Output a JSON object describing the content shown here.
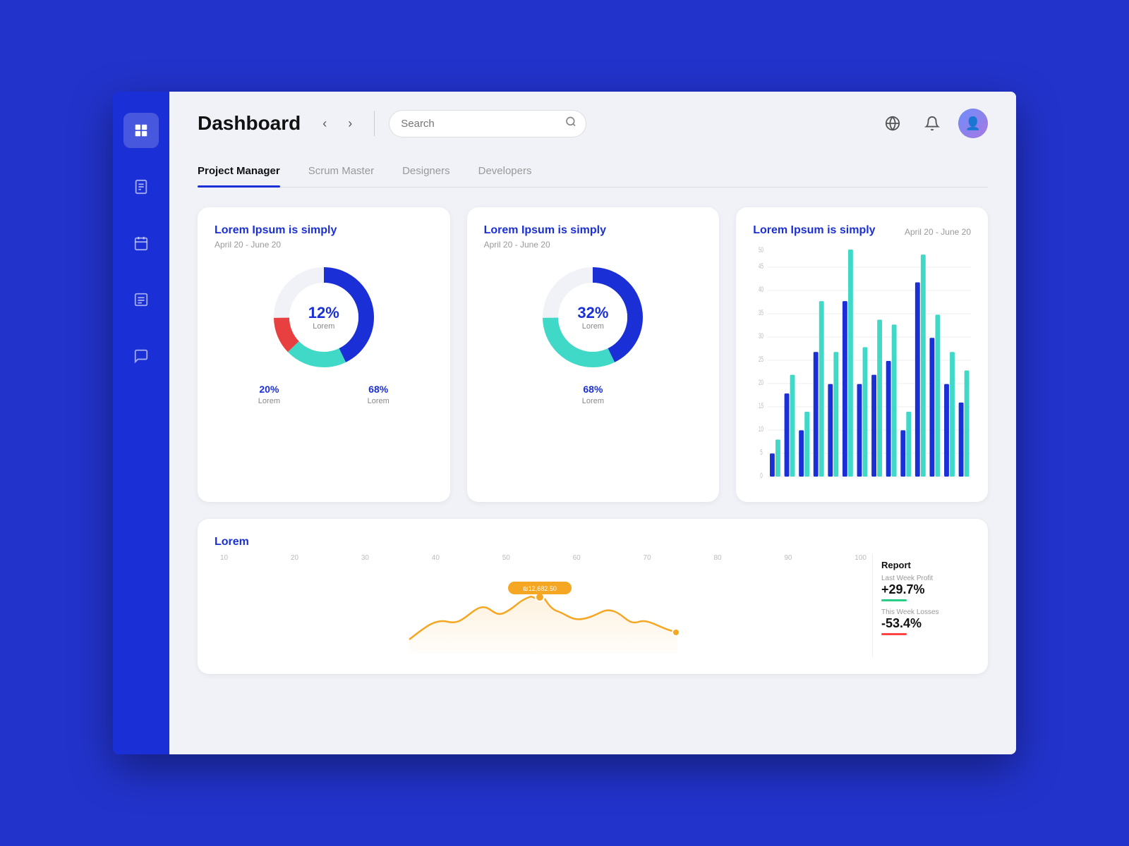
{
  "sidebar": {
    "items": [
      {
        "label": "dashboard",
        "icon": "🏛",
        "active": true
      },
      {
        "label": "reports",
        "icon": "📋",
        "active": false
      },
      {
        "label": "calendar",
        "icon": "📅",
        "active": false
      },
      {
        "label": "tasks",
        "icon": "📝",
        "active": false
      },
      {
        "label": "messages",
        "icon": "💬",
        "active": false
      }
    ]
  },
  "header": {
    "title": "Dashboard",
    "back_label": "‹",
    "forward_label": "›",
    "search_placeholder": "Search"
  },
  "tabs": [
    {
      "label": "Project Manager",
      "active": true
    },
    {
      "label": "Scrum Master",
      "active": false
    },
    {
      "label": "Designers",
      "active": false
    },
    {
      "label": "Developers",
      "active": false
    }
  ],
  "donut1": {
    "title": "Lorem Ipsum is simply",
    "subtitle": "April 20 - June 20",
    "center_pct": "12%",
    "center_label": "Lorem",
    "segments": [
      {
        "color": "#1a2fd6",
        "pct": 68,
        "label": "68%",
        "text": "Lorem"
      },
      {
        "color": "#40d9c8",
        "pct": 20,
        "label": "20%",
        "text": "Lorem"
      },
      {
        "color": "#e84040",
        "pct": 12,
        "label": "12%",
        "text": "Lorem"
      }
    ],
    "legend": [
      {
        "pct": "20%",
        "label": "Lorem",
        "color": "#40d9c8"
      },
      {
        "pct": "68%",
        "label": "Lorem",
        "color": "#1a2fd6"
      }
    ]
  },
  "donut2": {
    "title": "Lorem Ipsum is simply",
    "subtitle": "April 20 - June 20",
    "center_pct": "32%",
    "center_label": "Lorem",
    "segments": [
      {
        "color": "#1a2fd6",
        "pct": 68,
        "label": "68%",
        "text": "Lorem"
      },
      {
        "color": "#40d9c8",
        "pct": 32,
        "label": "32%",
        "text": "Lorem"
      }
    ],
    "legend": [
      {
        "pct": "68%",
        "label": "Lorem",
        "color": "#1a2fd6"
      }
    ]
  },
  "line_chart": {
    "title": "Lorem",
    "x_labels": [
      "10",
      "20",
      "30",
      "40",
      "50",
      "60",
      "70",
      "80",
      "90",
      "100"
    ],
    "highlight_value": "₪12,682.50",
    "report": {
      "title": "Report",
      "last_week_label": "Last Week Profit",
      "last_week_value": "+29.7%",
      "this_week_label": "This Week Losses",
      "this_week_value": "-53.4%"
    }
  },
  "bar_chart": {
    "title": "Lorem Ipsum is simply",
    "date_range": "April 20 - June 20",
    "y_labels": [
      "0",
      "5",
      "10",
      "15",
      "20",
      "25",
      "30",
      "35",
      "40",
      "45",
      "50"
    ],
    "bars": [
      {
        "dark": 5,
        "light": 8
      },
      {
        "dark": 18,
        "light": 22
      },
      {
        "dark": 10,
        "light": 14
      },
      {
        "dark": 27,
        "light": 38
      },
      {
        "dark": 20,
        "light": 27
      },
      {
        "dark": 38,
        "light": 52
      },
      {
        "dark": 20,
        "light": 28
      },
      {
        "dark": 22,
        "light": 34
      },
      {
        "dark": 25,
        "light": 33
      },
      {
        "dark": 10,
        "light": 14
      },
      {
        "dark": 42,
        "light": 48
      },
      {
        "dark": 30,
        "light": 35
      },
      {
        "dark": 20,
        "light": 27
      },
      {
        "dark": 16,
        "light": 23
      }
    ],
    "colors": {
      "dark": "#1a2fd6",
      "light": "#40d9c8"
    }
  }
}
